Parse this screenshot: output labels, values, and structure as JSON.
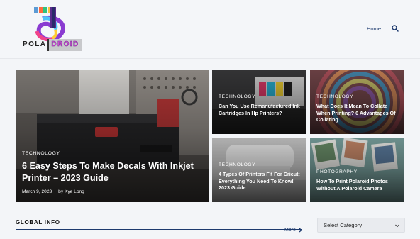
{
  "brand": {
    "logo_text_left": "POLA",
    "logo_text_right": "DROID"
  },
  "nav": {
    "home_label": "Home",
    "search_icon": "search-icon"
  },
  "featured": {
    "category": "TECHNOLOGY",
    "title": "6 Easy Steps To Make Decals With Inkjet Printer – 2023 Guide",
    "date": "March 9, 2023",
    "author": "by Kye Long"
  },
  "cards": [
    {
      "category": "TECHNOLOGY",
      "title": "Can You Use Remanufactured Ink Cartridges In Hp Printers?"
    },
    {
      "category": "TECHNOLOGY",
      "title": "What Does It Mean To Collate When Printing? 6 Advantages Of Collating"
    },
    {
      "category": "TECHNOLOGY",
      "title": "4 Types Of Printers Fit For Cricut: Everything You Need To Know! 2023 Guide"
    },
    {
      "category": "PHOTOGRAPHY",
      "title": "How To Print Polaroid Photos Without A Polaroid Camera"
    }
  ],
  "section": {
    "title": "GLOBAL INFO",
    "more_label": "More"
  },
  "category_select": {
    "selected": "Select Category"
  },
  "colors": {
    "accent": "#1d3a6e",
    "background": "#f3f5f8",
    "logo_pink": "#d34fd9"
  }
}
